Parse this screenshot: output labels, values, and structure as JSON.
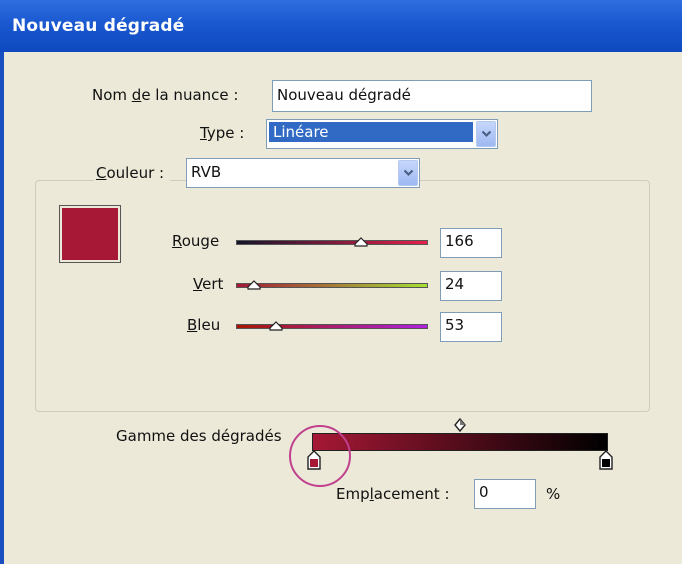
{
  "window": {
    "title": "Nouveau dégradé"
  },
  "swatch_name": {
    "label": "Nom de la nuance :",
    "label_pre": "Nom ",
    "label_ul": "d",
    "label_post": "e la nuance :",
    "value": "Nouveau dégradé"
  },
  "type": {
    "label_ul": "T",
    "label_post": "ype :",
    "selected": "Linéare"
  },
  "color_group": {
    "label_ul": "C",
    "label_post": "ouleur :",
    "mode": "RVB"
  },
  "swatch_color": "#a61835",
  "sliders": [
    {
      "label_ul": "R",
      "label_post": "ouge",
      "value": "166",
      "fraction": 0.65,
      "gradient_from": "#14142a",
      "gradient_to": "#e8204a"
    },
    {
      "label_ul": "V",
      "label_post": "ert",
      "value": "24",
      "fraction": 0.094,
      "gradient_from": "#a61835",
      "gradient_to": "#a6e035"
    },
    {
      "label_ul": "B",
      "label_post": "leu",
      "value": "53",
      "fraction": 0.208,
      "gradient_from": "#a61800",
      "gradient_to": "#b020e0"
    }
  ],
  "gradient": {
    "label": "Gamme des dégradés",
    "start_color": "#a61835",
    "end_color": "#000000",
    "midpoint": 0.5,
    "location_label_pre": "E",
    "location_label_mid": "mp",
    "location_label_ul": "l",
    "location_label_post": "acement :",
    "location_value": "0",
    "unit": "%"
  }
}
